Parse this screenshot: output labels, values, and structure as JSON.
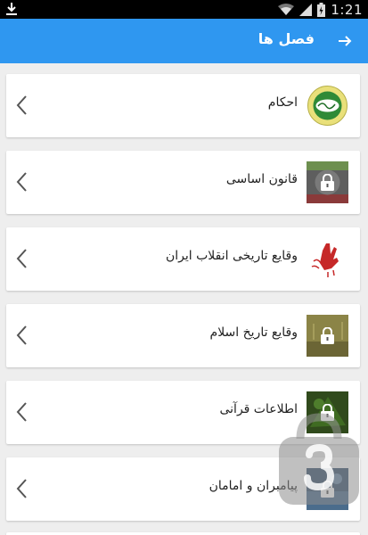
{
  "status_bar": {
    "time": "1:21",
    "download_icon": "download-icon",
    "wifi_icon": "wifi-icon",
    "signal_icon": "signal-icon",
    "battery_icon": "battery-icon"
  },
  "app_bar": {
    "title": "فصل ها",
    "back_icon": "arrow-right-icon",
    "color": "#2f97f0"
  },
  "items": [
    {
      "label": "احکام",
      "thumb": "ahkam-logo",
      "locked": false
    },
    {
      "label": "قانون اساسی",
      "thumb": "constitution-thumb",
      "locked": true
    },
    {
      "label": "وقایع تاریخی انقلاب ایران",
      "thumb": "revolution-thumb",
      "locked": false
    },
    {
      "label": "وقایع تاریخ اسلام",
      "thumb": "islam-history-thumb",
      "locked": true
    },
    {
      "label": "اطلاعات قرآنی",
      "thumb": "quran-thumb",
      "locked": true
    },
    {
      "label": "پیامبران و امامان",
      "thumb": "prophets-thumb",
      "locked": true
    }
  ],
  "chevron_icon": "chevron-left-icon",
  "watermark_icon": "bazaar-logo-icon"
}
